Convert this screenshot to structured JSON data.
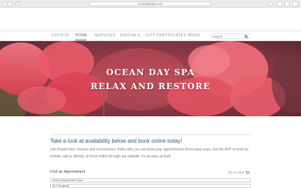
{
  "browser": {
    "url": "oceandayspa.com",
    "back": "‹",
    "forward": "›",
    "sidebar": "▢",
    "reload": "↻"
  },
  "nav": {
    "items": [
      "COVID19",
      "HOME",
      "SERVICES",
      "SPECIALS",
      "GIFT CERTIFICATES",
      "MORE"
    ],
    "active": "HOME",
    "search_placeholder": "Search"
  },
  "hero": {
    "line1": "OCEAN DAY SPA",
    "line2": "RELAX AND RESTORE"
  },
  "content": {
    "headline": "Take a look at availability below and book online today!",
    "paragraph": "Life should have choices and convenience, that's why you can book your appointments three easy ways. Get the APP to book by mobile, call us directly, or book online through our website. It's as easy as that!"
  },
  "appointment": {
    "heading": "Find an Appointment",
    "my_account": "My Account",
    "select_type": "Select Appointment Type",
    "select_location": "All Therapists"
  },
  "colors": {
    "headline": "#2f5f7f",
    "hero_bg": "#8b3d46",
    "petal": "#e8505f"
  }
}
